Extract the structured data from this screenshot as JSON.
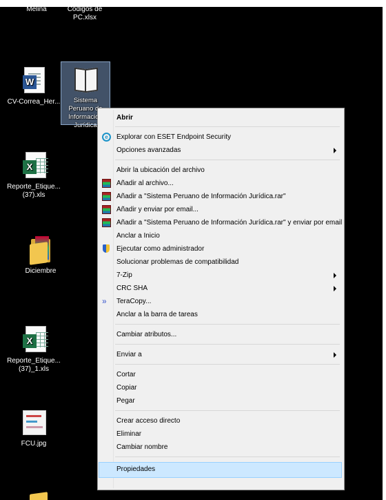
{
  "desktop": {
    "icons": [
      {
        "label": "Melina"
      },
      {
        "label": "Códigos de PC.xlsx"
      },
      {
        "label": "CV-Correa_Her..."
      },
      {
        "label": "Sistema Peruano de Información Jurídica"
      },
      {
        "label": "Reporte_Etique... (37).xls"
      },
      {
        "label": "Diciembre"
      },
      {
        "label": "Reporte_Etique... (37)_1.xls"
      },
      {
        "label": "FCU.jpg"
      }
    ]
  },
  "menu": {
    "items": [
      {
        "label": "Abrir"
      },
      {
        "label": "Explorar con ESET Endpoint Security",
        "icon": "eset-icon"
      },
      {
        "label": "Opciones avanzadas"
      },
      {
        "label": "Abrir la ubicación del archivo"
      },
      {
        "label": "Añadir al archivo...",
        "icon": "winrar-icon"
      },
      {
        "label": "Añadir a \"Sistema Peruano de Información Jurídica.rar\"",
        "icon": "winrar-icon"
      },
      {
        "label": "Añadir y enviar por email...",
        "icon": "winrar-icon"
      },
      {
        "label": "Añadir a \"Sistema Peruano de Información Jurídica.rar\" y enviar por email",
        "icon": "winrar-icon"
      },
      {
        "label": "Anclar a Inicio"
      },
      {
        "label": "Ejecutar como administrador",
        "icon": "uac-shield-icon"
      },
      {
        "label": "Solucionar problemas de compatibilidad"
      },
      {
        "label": "7-Zip"
      },
      {
        "label": "CRC SHA"
      },
      {
        "label": "TeraCopy...",
        "icon": "teracopy-icon"
      },
      {
        "label": "Anclar a la barra de tareas"
      },
      {
        "label": "Cambiar atributos..."
      },
      {
        "label": "Enviar a"
      },
      {
        "label": "Cortar"
      },
      {
        "label": "Copiar"
      },
      {
        "label": "Pegar"
      },
      {
        "label": "Crear acceso directo"
      },
      {
        "label": "Eliminar"
      },
      {
        "label": "Cambiar nombre"
      },
      {
        "label": "Propiedades"
      }
    ],
    "highlight_color": "#cce8ff",
    "background": "#f0f0f0"
  },
  "colors": {
    "desktop": "#000000",
    "selection": "#7896be"
  }
}
